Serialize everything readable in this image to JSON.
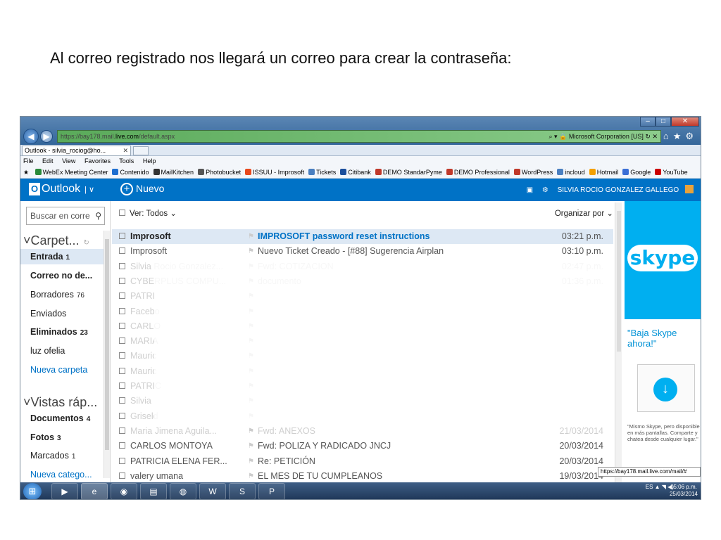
{
  "slide": {
    "title": "Al correo registrado nos llegará un correo para crear la contraseña:"
  },
  "browser": {
    "url_prefix": "https://bay178.mail.",
    "url_host": "live.com",
    "url_rest": "/default.aspx",
    "cert": "Microsoft Corporation [US]",
    "tab_title": "Outlook - silvia_rociog@ho...",
    "menu": [
      "File",
      "Edit",
      "View",
      "Favorites",
      "Tools",
      "Help"
    ],
    "favorites": [
      {
        "label": "WebEx Meeting Center",
        "color": "#2a8a3a"
      },
      {
        "label": "Contenido",
        "color": "#1e6fd0"
      },
      {
        "label": "MailKitchen",
        "color": "#333333"
      },
      {
        "label": "Photobucket",
        "color": "#555555"
      },
      {
        "label": "ISSUU - Improsoft",
        "color": "#e8491d"
      },
      {
        "label": "Tickets",
        "color": "#4a7fc0"
      },
      {
        "label": "Citibank",
        "color": "#1b4f9c"
      },
      {
        "label": "DEMO StandarPyme",
        "color": "#c0392b"
      },
      {
        "label": "DEMO Professional",
        "color": "#c0392b"
      },
      {
        "label": "WordPress",
        "color": "#c0392b"
      },
      {
        "label": "incloud",
        "color": "#4a7fc0"
      },
      {
        "label": "Hotmail",
        "color": "#f4a000"
      },
      {
        "label": "Google",
        "color": "#3b6fd6"
      },
      {
        "label": "YouTube",
        "color": "#cc0000"
      }
    ]
  },
  "outlook": {
    "brand": "Outlook",
    "new_label": "Nuevo",
    "user_name": "SILVIA ROCIO GONZALEZ GALLEGO",
    "search_placeholder": "Buscar en corre",
    "folders_header": "Carpet...",
    "folders": [
      {
        "label": "Entrada",
        "count": "1",
        "bold": true
      },
      {
        "label": "Correo no de...",
        "count": "",
        "bold": true
      },
      {
        "label": "Borradores",
        "count": "76",
        "bold": false
      },
      {
        "label": "Enviados",
        "count": "",
        "bold": false
      },
      {
        "label": "Eliminados",
        "count": "23",
        "bold": true
      },
      {
        "label": "luz ofelia",
        "count": "",
        "bold": false
      }
    ],
    "new_folder": "Nueva carpeta",
    "quick_header": "Vistas ráp...",
    "quick_views": [
      {
        "label": "Documentos",
        "count": "4",
        "bold": true
      },
      {
        "label": "Fotos",
        "count": "3",
        "bold": true
      },
      {
        "label": "Marcados",
        "count": "1",
        "bold": false
      }
    ],
    "new_category": "Nueva catego...",
    "filter_label": "Ver: Todos",
    "sort_label": "Organizar por",
    "messages": [
      {
        "from": "Improsoft",
        "subject": "IMPROSOFT password reset instructions",
        "time": "03:21 p.m.",
        "state": "unread"
      },
      {
        "from": "Improsoft",
        "subject": "Nuevo Ticket Creado - [#88] Sugerencia Airplan",
        "time": "03:10 p.m.",
        "state": "read"
      },
      {
        "from": "Silvia Rocio Gonzalez...",
        "subject": "Fwd: COTIZACION",
        "time": "02:47 p.m.",
        "state": "faded"
      },
      {
        "from": "CYBERPLUS COMPU...",
        "subject": "documento",
        "time": "01:36 p.m.",
        "state": "faded"
      },
      {
        "from": "PATRI",
        "subject": "",
        "time": "",
        "state": "faded"
      },
      {
        "from": "Facebo",
        "subject": "",
        "time": "",
        "state": "faded"
      },
      {
        "from": "CARLO",
        "subject": "",
        "time": "",
        "state": "faded"
      },
      {
        "from": "MARIA",
        "subject": "",
        "time": "",
        "state": "faded"
      },
      {
        "from": "Mauric",
        "subject": "",
        "time": "",
        "state": "faded"
      },
      {
        "from": "Mauric",
        "subject": "",
        "time": "",
        "state": "faded"
      },
      {
        "from": "PATRIC",
        "subject": "",
        "time": "",
        "state": "faded"
      },
      {
        "from": "Silvia",
        "subject": "",
        "time": "",
        "state": "faded"
      },
      {
        "from": "Griseld",
        "subject": "",
        "time": "",
        "state": "faded"
      },
      {
        "from": "Maria Jimena Aguila...",
        "subject": "Fwd: ANEXOS",
        "time": "21/03/2014",
        "state": "faded"
      },
      {
        "from": "CARLOS MONTOYA",
        "subject": "Fwd: POLIZA Y RADICADO JNCJ",
        "time": "20/03/2014",
        "state": "read"
      },
      {
        "from": "PATRICIA ELENA FER...",
        "subject": "Re: PETICIÓN",
        "time": "20/03/2014",
        "state": "read"
      },
      {
        "from": "valery umana",
        "subject": "EL MES DE TU CUMPLEANOS",
        "time": "19/03/2014",
        "state": "read"
      }
    ]
  },
  "ad": {
    "brand": "skype",
    "headline": "\"Baja Skype ahora!\"",
    "small": "\"Mismo Skype, pero disponible en más pantallas. Comparte y chatea desde cualquier lugar.\""
  },
  "status_url": "https://bay178.mail.live.com/mail/#",
  "taskbar": {
    "lang": "ES",
    "time": "05:06 p.m.",
    "date": "25/03/2014"
  }
}
